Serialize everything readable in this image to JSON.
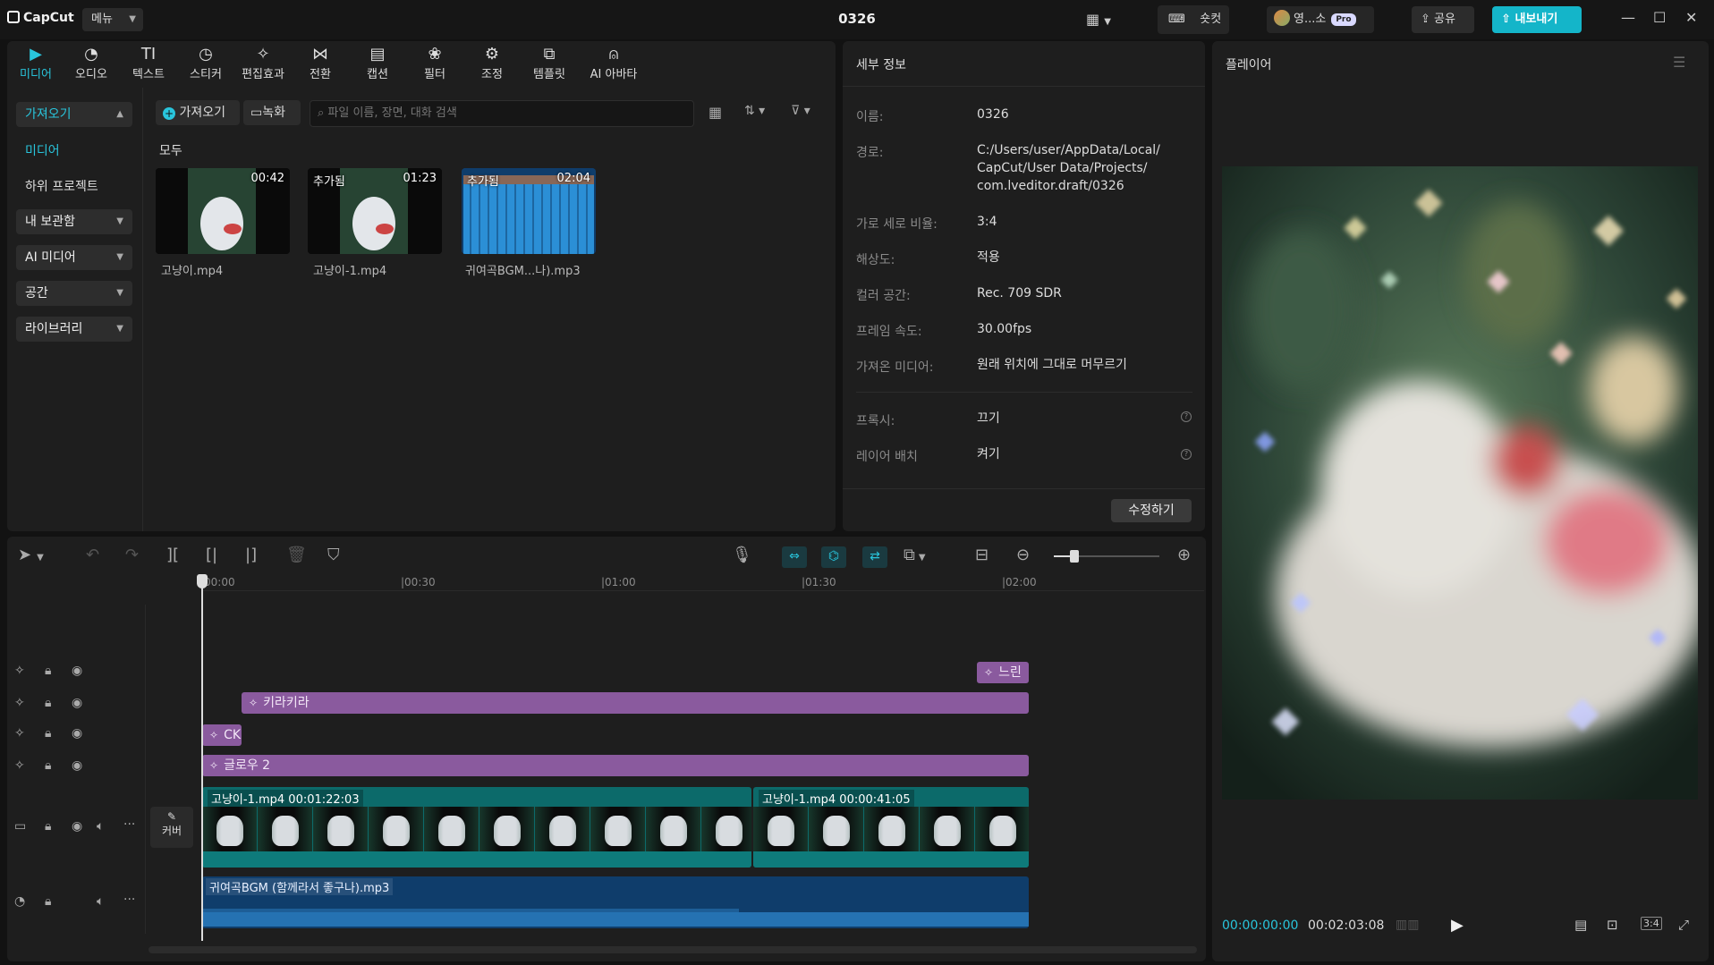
{
  "app": {
    "logo": "CapCut",
    "menu_label": "메뉴",
    "project_title": "0326",
    "shortcut_label": "숏컷",
    "user_label": "영...소",
    "pro_badge": "Pro",
    "share_label": "공유",
    "export_label": "내보내기"
  },
  "tabs": [
    {
      "label": "미디어",
      "icon": "▶"
    },
    {
      "label": "오디오",
      "icon": "◔"
    },
    {
      "label": "텍스트",
      "icon": "TI"
    },
    {
      "label": "스티커",
      "icon": "◷"
    },
    {
      "label": "편집효과",
      "icon": "✧"
    },
    {
      "label": "전환",
      "icon": "⋈"
    },
    {
      "label": "캡션",
      "icon": "▤"
    },
    {
      "label": "필터",
      "icon": "❀"
    },
    {
      "label": "조정",
      "icon": "⚙"
    },
    {
      "label": "템플릿",
      "icon": "⧉"
    },
    {
      "label": "AI 아바타",
      "icon": "⍝"
    }
  ],
  "sidenav": {
    "import": "가져오기",
    "media": "미디어",
    "subproject": "하위 프로젝트",
    "my_storage": "내 보관함",
    "ai_media": "AI 미디어",
    "space": "공간",
    "library": "라이브러리"
  },
  "media": {
    "import_btn": "가져오기",
    "record_btn": "녹화",
    "search_placeholder": "파일 이름, 장면, 대화 검색",
    "all_label": "모두",
    "items": [
      {
        "name": "고냥이.mp4",
        "duration": "00:42",
        "added": ""
      },
      {
        "name": "고냥이-1.mp4",
        "duration": "01:23",
        "added": "추가됨"
      },
      {
        "name": "귀여곡BGM...나).mp3",
        "duration": "02:04",
        "added": "추가됨"
      }
    ]
  },
  "details": {
    "title": "세부 정보",
    "rows": [
      {
        "label": "이름:",
        "value": "0326"
      },
      {
        "label": "경로:",
        "value": "C:/Users/user/AppData/Local/ CapCut/User Data/Projects/ com.lveditor.draft/0326"
      },
      {
        "label": "가로 세로 비율:",
        "value": "3:4"
      },
      {
        "label": "해상도:",
        "value": "적용"
      },
      {
        "label": "컬러 공간:",
        "value": "Rec. 709 SDR"
      },
      {
        "label": "프레임 속도:",
        "value": "30.00fps"
      },
      {
        "label": "가져온 미디어:",
        "value": "원래 위치에 그대로 머무르기"
      }
    ],
    "proxy_label": "프록시:",
    "proxy_value": "끄기",
    "layer_label": "레이어 배치",
    "layer_value": "켜기",
    "modify_btn": "수정하기"
  },
  "player": {
    "title": "플레이어",
    "current_time": "00:00:00:00",
    "total_time": "00:02:03:08",
    "ratio": "3:4"
  },
  "timeline": {
    "ruler": [
      "00:00",
      "|00:30",
      "|01:00",
      "|01:30",
      "|02:00"
    ],
    "fx_clips": [
      {
        "label": "느린"
      },
      {
        "label": "키라키라"
      },
      {
        "label": "CK"
      },
      {
        "label": "글로우 2"
      }
    ],
    "video_clips": [
      {
        "label": "고냥이-1.mp4  00:01:22:03"
      },
      {
        "label": "고냥이-1.mp4  00:00:41:05"
      }
    ],
    "audio_clip": "귀여곡BGM (함께라서 좋구나).mp3",
    "cover_label": "커버"
  },
  "colors": {
    "accent": "#29c5dc",
    "fx_clip": "#8a5a9e",
    "video_clip": "#0c6a6a",
    "audio_clip": "#0f3d6b",
    "export": "#14b5c9"
  }
}
